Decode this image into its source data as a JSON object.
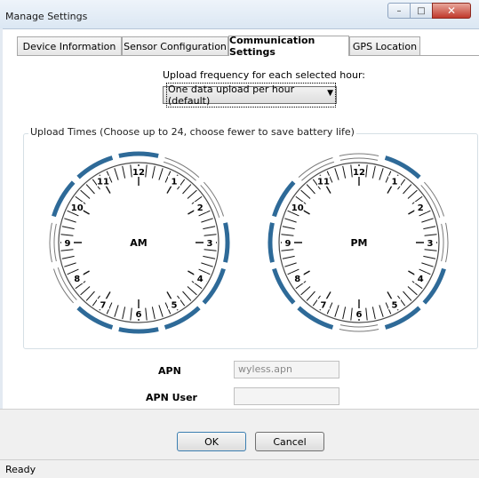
{
  "window": {
    "title": "Manage Settings",
    "controls": {
      "minimize": "–",
      "maximize": "□",
      "close": "✕"
    }
  },
  "tabs": [
    {
      "label": "Device Information",
      "active": false
    },
    {
      "label": "Sensor Configuration",
      "active": false
    },
    {
      "label": "Communication Settings",
      "active": true
    },
    {
      "label": "GPS Location",
      "active": false
    }
  ],
  "upload": {
    "frequency_label": "Upload frequency for each selected hour:",
    "frequency_value": "One data upload per hour (default)",
    "times_label": "Upload Times (Choose up to 24, choose fewer to save battery life)"
  },
  "clocks": {
    "accent": "#2e6a98",
    "am": {
      "label": "AM",
      "numbers": [
        "12",
        "1",
        "2",
        "3",
        "4",
        "5",
        "6",
        "7",
        "8",
        "9",
        "10",
        "11"
      ],
      "selected_hours": [
        0,
        3,
        4,
        5,
        6,
        7,
        10,
        11
      ]
    },
    "pm": {
      "label": "PM",
      "numbers": [
        "12",
        "1",
        "2",
        "3",
        "4",
        "5",
        "6",
        "7",
        "8",
        "9",
        "10",
        "11"
      ],
      "selected_hours": [
        1,
        4,
        5,
        7,
        8,
        9,
        10
      ]
    }
  },
  "form": {
    "apn_label": "APN",
    "apn_value": "wyless.apn",
    "apn_user_label": "APN User",
    "apn_user_value": ""
  },
  "buttons": {
    "ok": "OK",
    "cancel": "Cancel"
  },
  "status": {
    "text": "Ready"
  }
}
